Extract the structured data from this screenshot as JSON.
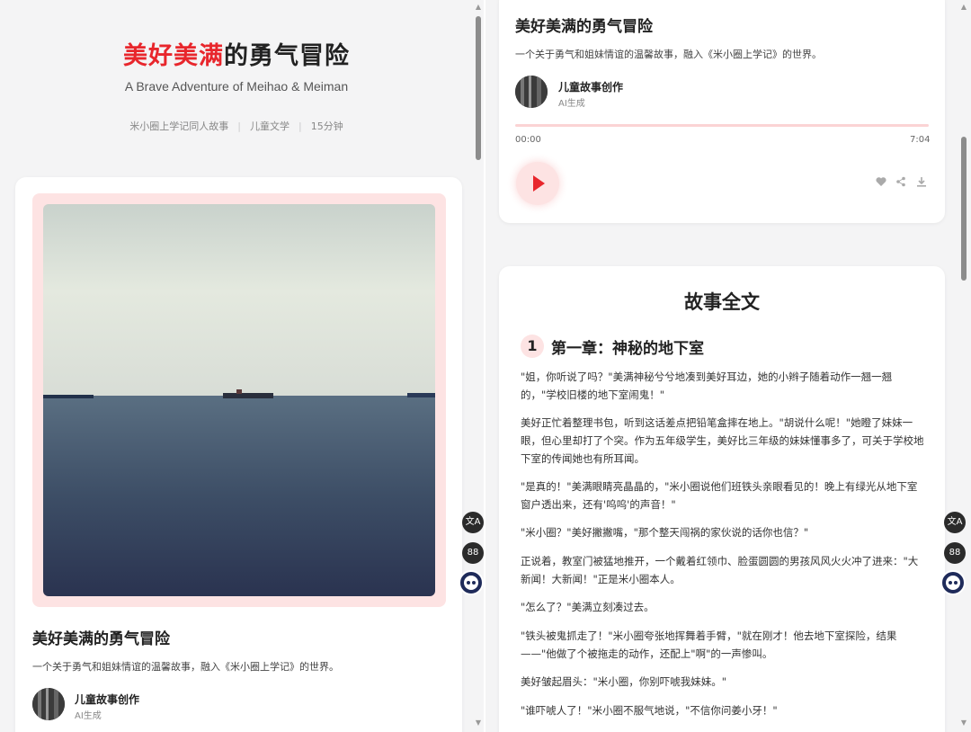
{
  "book": {
    "title_accent": "美好美满",
    "title_rest": "的勇气冒险",
    "subtitle": "A Brave Adventure of Meihao & Meiman",
    "meta": [
      "米小圈上学记同人故事",
      "儿童文学",
      "15分钟"
    ]
  },
  "story": {
    "title": "美好美满的勇气冒险",
    "description": "一个关于勇气和姐妹情谊的温馨故事，融入《米小圈上学记》的世界。",
    "author_name": "儿童故事创作",
    "author_role": "AI生成"
  },
  "player": {
    "current_time": "00:00",
    "duration": "7:04",
    "progress": 0,
    "icons": [
      "play-icon",
      "heart-icon",
      "share-icon",
      "download-icon"
    ]
  },
  "floating": {
    "icons": [
      "translate-icon",
      "apps-icon",
      "assistant-bot-icon"
    ],
    "translate_glyph": "文A",
    "apps_glyph": "88"
  },
  "fulltext": {
    "heading": "故事全文",
    "chapter_number": "1",
    "chapter_title": "第一章：神秘的地下室",
    "paragraphs": [
      "\"姐，你听说了吗？\"美满神秘兮兮地凑到美好耳边，她的小辫子随着动作一翘一翘的，\"学校旧楼的地下室闹鬼！\"",
      "美好正忙着整理书包，听到这话差点把铅笔盒摔在地上。\"胡说什么呢！\"她瞪了妹妹一眼，但心里却打了个突。作为五年级学生，美好比三年级的妹妹懂事多了，可关于学校地下室的传闻她也有所耳闻。",
      "\"是真的！\"美满眼睛亮晶晶的，\"米小圈说他们班铁头亲眼看见的！晚上有绿光从地下室窗户透出来，还有'呜呜'的声音！\"",
      "\"米小圈？\"美好撇撇嘴，\"那个整天闯祸的家伙说的话你也信？\"",
      "正说着，教室门被猛地推开，一个戴着红领巾、脸蛋圆圆的男孩风风火火冲了进来：\"大新闻！大新闻！\"正是米小圈本人。",
      "\"怎么了？\"美满立刻凑过去。",
      "\"铁头被鬼抓走了！\"米小圈夸张地挥舞着手臂，\"就在刚才！他去地下室探险，结果——\"他做了个被拖走的动作，还配上\"啊\"的一声惨叫。",
      "美好皱起眉头：\"米小圈，你别吓唬我妹妹。\"",
      "\"谁吓唬人了！\"米小圈不服气地说，\"不信你问姜小牙！\""
    ]
  },
  "colors": {
    "accent": "#e8262c",
    "soft_pink": "#fde3e3",
    "background": "#f4f4f5"
  }
}
